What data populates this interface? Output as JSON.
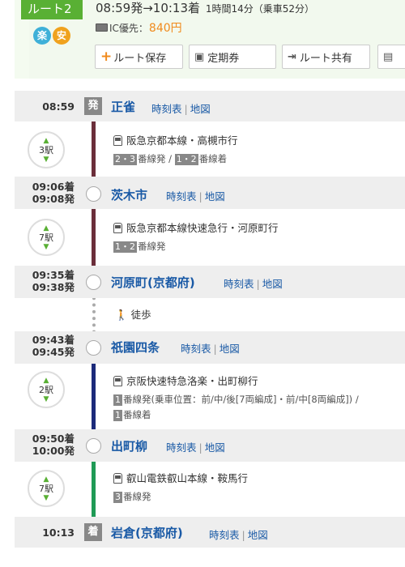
{
  "header": {
    "route_tab": "ルート2",
    "badge_raku": "楽",
    "badge_yasu": "安",
    "time_summary": "08:59発→10:13着",
    "duration": "1時間14分（乗車52分）",
    "fare_label": "IC優先：",
    "fare_value": "840円",
    "buttons": {
      "save": "ルート保存",
      "pass": "定期券",
      "share": "ルート共有"
    }
  },
  "stations": [
    {
      "arr": "",
      "dep": "08:59",
      "name": "正雀",
      "timetable": "時刻表",
      "map": "地図",
      "marker": "発"
    },
    {
      "arr": "09:06着",
      "dep": "09:08発",
      "name": "茨木市",
      "timetable": "時刻表",
      "map": "地図"
    },
    {
      "arr": "09:35着",
      "dep": "09:38発",
      "name": "河原町(京都府)",
      "timetable": "時刻表",
      "map": "地図"
    },
    {
      "arr": "09:43着",
      "dep": "09:45発",
      "name": "祇園四条",
      "timetable": "時刻表",
      "map": "地図"
    },
    {
      "arr": "09:50着",
      "dep": "10:00発",
      "name": "出町柳",
      "timetable": "時刻表",
      "map": "地図"
    },
    {
      "arr": "",
      "dep": "10:13",
      "name": "岩倉(京都府)",
      "timetable": "時刻表",
      "map": "地図",
      "marker": "着"
    }
  ],
  "legs": [
    {
      "count": "3駅",
      "line": "阪急京都本線・高槻市行",
      "track_dep": "2・3",
      "track_dep_suffix": "番線発",
      "sep": " / ",
      "track_arr": "1・2",
      "track_arr_suffix": "番線着",
      "color": "#6b2e3a"
    },
    {
      "count": "7駅",
      "line": "阪急京都本線快速急行・河原町行",
      "track_dep": "1・2",
      "track_dep_suffix": "番線発",
      "color": "#6b2e3a"
    },
    {
      "walk": "徒歩"
    },
    {
      "count": "2駅",
      "line": "京阪快速特急洛楽・出町柳行",
      "track_dep": "1",
      "track_dep_suffix": "番線発(乗車位置：前/中/後[7両編成]・前/中[8両編成]) /",
      "track_arr": "1",
      "track_arr_suffix": "番線着",
      "color": "#1b2a7a"
    },
    {
      "count": "7駅",
      "line": "叡山電鉄叡山本線・鞍馬行",
      "track_dep": "3",
      "track_dep_suffix": "番線発",
      "color": "#1f9a55"
    }
  ],
  "colors": {
    "accent": "#59b034",
    "link": "#1a5aa6",
    "price": "#f08a1c"
  }
}
